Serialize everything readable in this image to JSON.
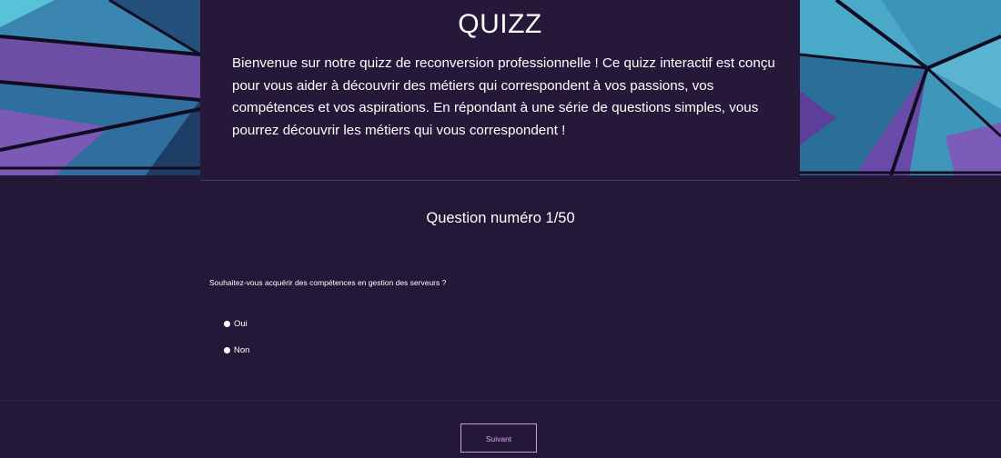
{
  "header": {
    "title": "QUIZZ",
    "intro": "Bienvenue sur notre quizz de reconversion professionnelle ! Ce quizz interactif est conçu pour vous aider à découvrir des métiers qui correspondent à vos passions, vos compétences et vos aspirations. En répondant à une série de questions simples, vous pourrez découvrir les métiers qui vous correspondent !"
  },
  "question": {
    "counter": "Question numéro 1/50",
    "text": "Souhaitez-vous acquérir des compétences en gestion des serveurs ?",
    "options": [
      {
        "label": "Oui"
      },
      {
        "label": "Non"
      }
    ]
  },
  "actions": {
    "next_label": "Suivant"
  },
  "colors": {
    "background": "#231838",
    "accent": "#c79be0",
    "deco_teal": "#3f98b8",
    "deco_purple": "#6a4aa8"
  },
  "icons": {
    "deco_left": "geometric-crystal-image",
    "deco_right": "geometric-crystal-image"
  }
}
